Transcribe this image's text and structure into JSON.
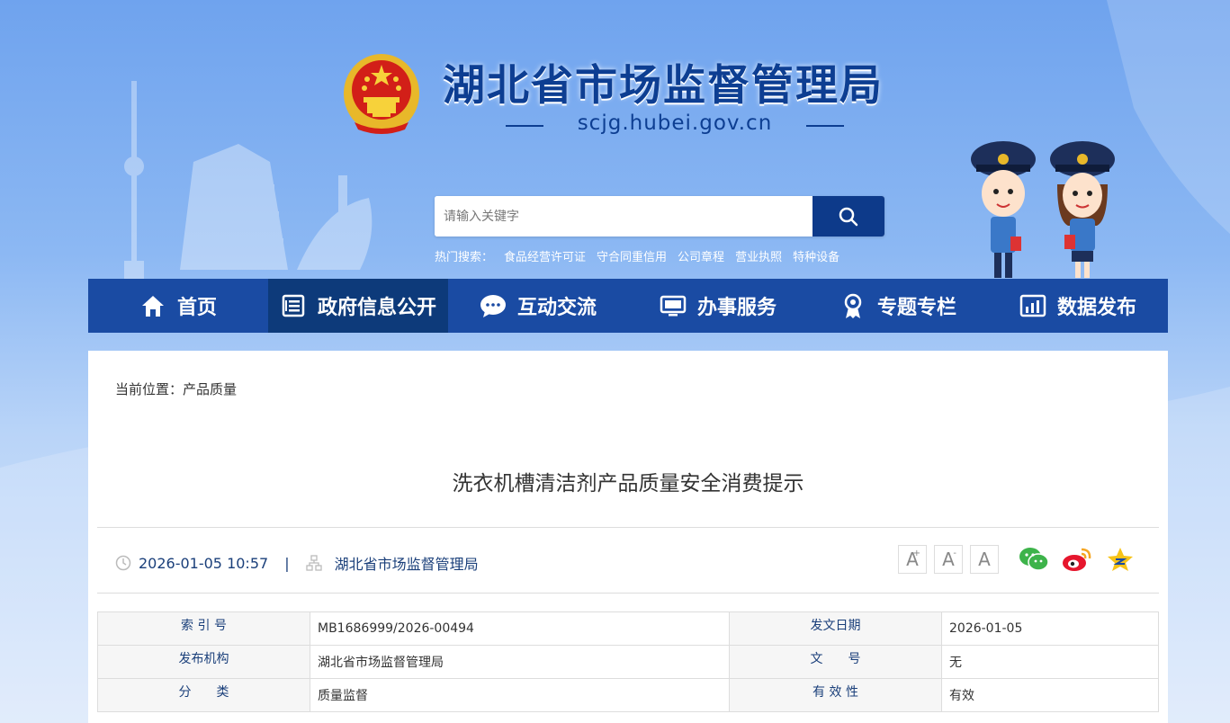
{
  "header": {
    "site_title": "湖北省市场监督管理局",
    "site_domain": "scjg.hubei.gov.cn",
    "emblem_icon": "national-emblem-icon"
  },
  "search": {
    "placeholder": "请输入关键字",
    "button_icon": "search-icon",
    "hot_label": "热门搜索：",
    "hot_terms": [
      "食品经营许可证",
      "守合同重信用",
      "公司章程",
      "营业执照",
      "特种设备"
    ]
  },
  "nav": {
    "items": [
      {
        "label": "首页",
        "icon": "home-icon"
      },
      {
        "label": "政府信息公开",
        "icon": "document-list-icon"
      },
      {
        "label": "互动交流",
        "icon": "chat-bubble-icon"
      },
      {
        "label": "办事服务",
        "icon": "monitor-icon"
      },
      {
        "label": "专题专栏",
        "icon": "badge-icon"
      },
      {
        "label": "数据发布",
        "icon": "bar-chart-icon"
      }
    ],
    "active_index": 1
  },
  "breadcrumb": "当前位置：产品质量",
  "article": {
    "title": "洗衣机槽清洁剂产品质量安全消费提示",
    "datetime": "2026-01-05 10:57",
    "separator": "|",
    "source": "湖北省市场监督管理局"
  },
  "font_controls": {
    "increase": "A",
    "increase_sup": "+",
    "decrease": "A",
    "decrease_sup": "-",
    "reset": "A"
  },
  "share": [
    "wechat-icon",
    "weibo-icon",
    "qzone-icon"
  ],
  "info": {
    "index_no_label": "索 引 号",
    "index_no": "MB1686999/2026-00494",
    "pub_date_label": "发文日期",
    "pub_date": "2026-01-05",
    "issuer_label": "发布机构",
    "issuer": "湖北省市场监督管理局",
    "doc_no_label": "文　　号",
    "doc_no": "无",
    "category_label": "分　　类",
    "category": "质量监督",
    "validity_label": "有 效 性",
    "validity": "有效"
  },
  "colors": {
    "primary": "#1a4ba3",
    "primary_dark": "#0d3a7a",
    "title_blue": "#0d3e92"
  }
}
